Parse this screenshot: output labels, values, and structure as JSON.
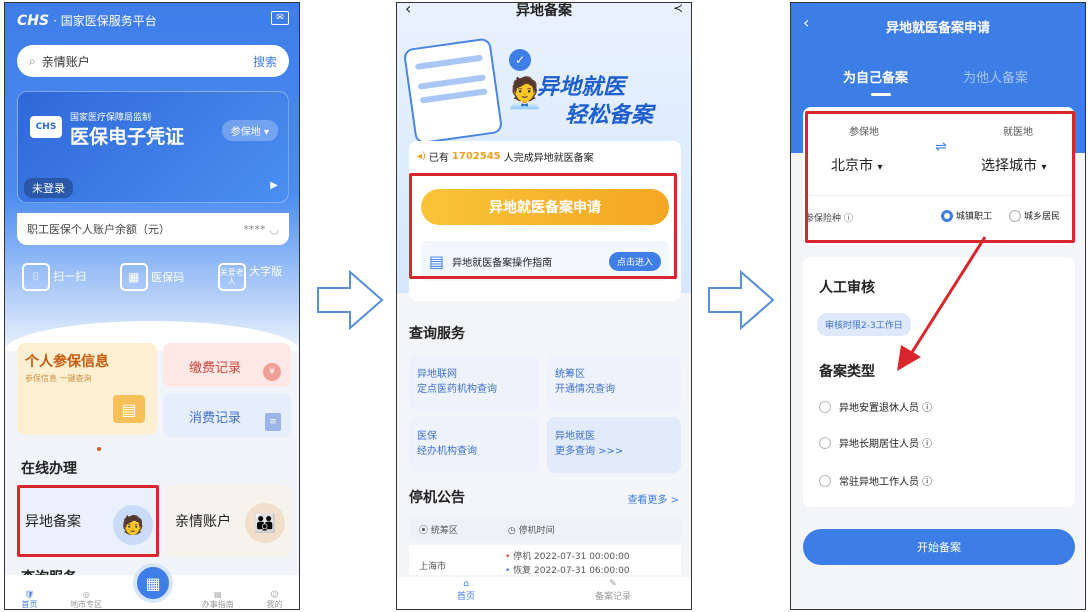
{
  "p1": {
    "logo": "CHS",
    "platform": "· 国家医保服务平台",
    "search_placeholder": "亲情账户",
    "search_btn": "搜索",
    "bureau": "国家医疗保障局监制",
    "cert_title": "医保电子凭证",
    "region_btn": "参保地 ▾",
    "login": "未登录",
    "balance_label": "职工医保个人账户余额（元）",
    "balance_mask": "****",
    "scan": "扫一扫",
    "code": "医保码",
    "bigfont": "大字版",
    "care_icon_text": "关爱老人",
    "personal_info": "个人参保信息",
    "personal_sub": "参保信息 一键查询",
    "payment": "缴费记录",
    "consume": "消费记录",
    "online": "在线办理",
    "remote": "异地备案",
    "family": "亲情账户",
    "query_partial": "查询服务",
    "nav": [
      "首页",
      "地市专区",
      "",
      "办事指南",
      "我的"
    ]
  },
  "p2": {
    "title": "异地备案",
    "banner1": "异地就医",
    "banner2": "轻松备案",
    "count_pre": "已有",
    "count": "1702545",
    "count_post": "人完成异地就医备案",
    "apply_btn": "异地就医备案申请",
    "guide": "异地就医备案操作指南",
    "guide_btn": "点击进入",
    "query_title": "查询服务",
    "tiles": [
      [
        "异地联网",
        "定点医药机构查询"
      ],
      [
        "统筹区",
        "开通情况查询"
      ],
      [
        "医保",
        "经办机构查询"
      ],
      [
        "异地就医",
        "更多查询 >>>"
      ]
    ],
    "notice_title": "停机公告",
    "more": "查看更多 >",
    "col1": "统筹区",
    "col2": "停机时间",
    "city": "上海市",
    "rows": [
      "停机  2022-07-31 00:00:00",
      "恢复  2022-07-31 06:00:00"
    ],
    "nav": [
      "首页",
      "备案记录"
    ]
  },
  "p3": {
    "title": "异地就医备案申请",
    "tab_self": "为自己备案",
    "tab_other": "为他人备案",
    "insured_label": "参保地",
    "insured_val": "北京市",
    "treat_label": "就医地",
    "treat_val": "选择城市",
    "type_label": "参保险种 ⓘ",
    "opt1": "城镇职工",
    "opt2": "城乡居民",
    "review_title": "人工审核",
    "review_badge": "审核时限2-3工作日",
    "category_title": "备案类型",
    "cats": [
      "异地安置退休人员 ⓘ",
      "异地长期居住人员 ⓘ",
      "常驻异地工作人员 ⓘ"
    ],
    "start_btn": "开始备案"
  },
  "colors": {
    "blue": "#3f7de8",
    "red": "#d9262c",
    "orange": "#f7b21e"
  }
}
